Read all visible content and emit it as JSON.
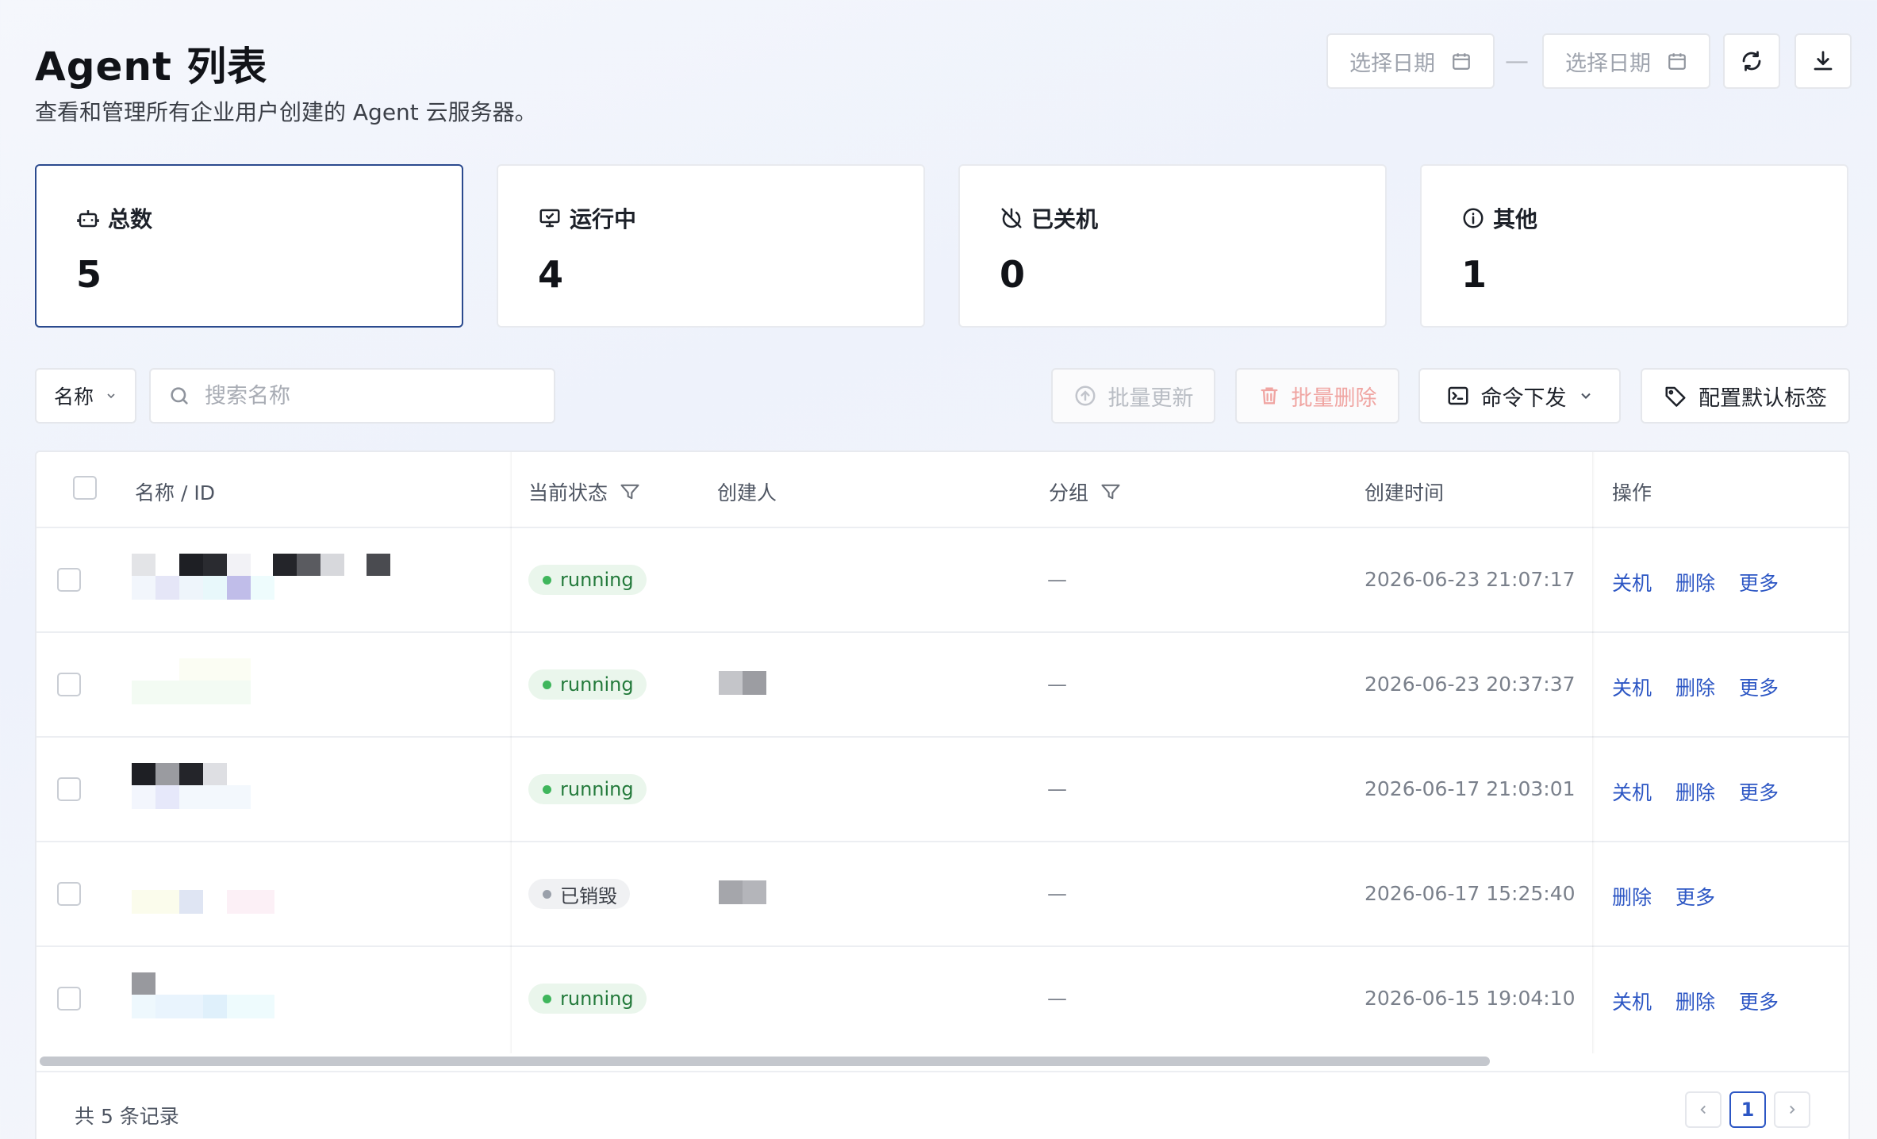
{
  "header": {
    "title": "Agent 列表",
    "subtitle": "查看和管理所有企业用户创建的 Agent 云服务器。",
    "date_start_placeholder": "选择日期",
    "date_end_placeholder": "选择日期",
    "date_separator": "—"
  },
  "stats": [
    {
      "label": "总数",
      "value": "5",
      "icon": "robot-icon"
    },
    {
      "label": "运行中",
      "value": "4",
      "icon": "monitor-check-icon"
    },
    {
      "label": "已关机",
      "value": "0",
      "icon": "power-off-icon"
    },
    {
      "label": "其他",
      "value": "1",
      "icon": "info-icon"
    }
  ],
  "filters": {
    "field_select": "名称",
    "search_placeholder": "搜索名称",
    "search_value": ""
  },
  "toolbar": {
    "batch_update": "批量更新",
    "batch_delete": "批量删除",
    "command_dispatch": "命令下发",
    "default_tags": "配置默认标签"
  },
  "table": {
    "columns": {
      "name": "名称 / ID",
      "status": "当前状态",
      "creator": "创建人",
      "group": "分组",
      "created_at": "创建时间",
      "actions": "操作"
    },
    "rows": [
      {
        "status": "running",
        "status_type": "running",
        "group": "—",
        "created_at": "2026-06-23 21:07:17",
        "actions": [
          "关机",
          "删除",
          "更多"
        ]
      },
      {
        "status": "running",
        "status_type": "running",
        "group": "—",
        "created_at": "2026-06-23 20:37:37",
        "actions": [
          "关机",
          "删除",
          "更多"
        ]
      },
      {
        "status": "running",
        "status_type": "running",
        "group": "—",
        "created_at": "2026-06-17 21:03:01",
        "actions": [
          "关机",
          "删除",
          "更多"
        ]
      },
      {
        "status": "已销毁",
        "status_type": "destroyed",
        "group": "—",
        "created_at": "2026-06-17 15:25:40",
        "actions": [
          "删除",
          "更多"
        ]
      },
      {
        "status": "running",
        "status_type": "running",
        "group": "—",
        "created_at": "2026-06-15 19:04:10",
        "actions": [
          "关机",
          "删除",
          "更多"
        ]
      }
    ]
  },
  "footer": {
    "total_text": "共 5 条记录",
    "current_page": "1"
  },
  "colors": {
    "accent": "#2c56c4",
    "active_card_border": "#2b4a8e",
    "running_green": "#3fb65c"
  }
}
